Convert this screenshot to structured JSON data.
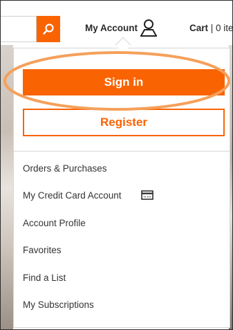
{
  "header": {
    "search_icon": "magnifier-icon",
    "account_label": "My Account",
    "account_icon": "user-icon",
    "cart_label": "Cart",
    "cart_count": "| 0 ite"
  },
  "dropdown": {
    "signin_label": "Sign in",
    "register_label": "Register",
    "items": [
      {
        "label": "Orders & Purchases"
      },
      {
        "label": "My Credit Card Account",
        "icon": "credit-card-icon"
      },
      {
        "label": "Account Profile"
      },
      {
        "label": "Favorites"
      },
      {
        "label": "Find a List"
      },
      {
        "label": "My Subscriptions"
      }
    ]
  },
  "colors": {
    "brand_orange": "#f96302",
    "highlight_orange": "#f5a05a"
  }
}
